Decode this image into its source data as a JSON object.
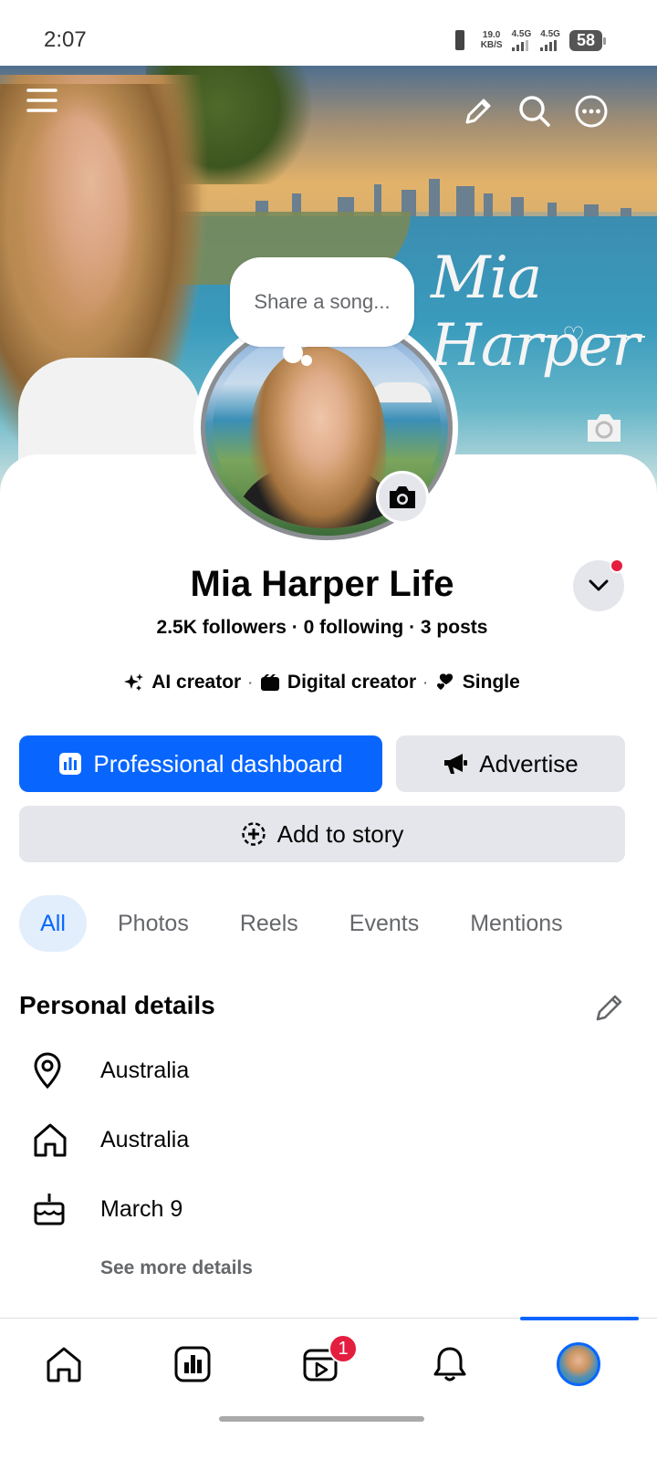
{
  "status_bar": {
    "time": "2:07",
    "net_speed_value": "19.0",
    "net_speed_unit": "KB/S",
    "signal1_label": "4.5G",
    "signal2_label": "4.5G",
    "battery": "58"
  },
  "cover": {
    "script_text": "Mia Harper",
    "heart": "♡"
  },
  "profile": {
    "song_prompt": "Share a song...",
    "name": "Mia Harper Life",
    "stats": "2.5K followers · 0 following · 3 posts",
    "tags": [
      {
        "label": "AI creator",
        "icon": "sparkle-icon"
      },
      {
        "label": "Digital creator",
        "icon": "clapper-icon"
      },
      {
        "label": "Single",
        "icon": "hearts-icon"
      }
    ],
    "tag_separator": "·"
  },
  "actions": {
    "dashboard": "Professional dashboard",
    "advertise": "Advertise",
    "add_story": "Add to story"
  },
  "tabs": [
    {
      "label": "All",
      "active": true
    },
    {
      "label": "Photos",
      "active": false
    },
    {
      "label": "Reels",
      "active": false
    },
    {
      "label": "Events",
      "active": false
    },
    {
      "label": "Mentions",
      "active": false
    }
  ],
  "personal_details": {
    "title": "Personal details",
    "items": [
      {
        "icon": "location-pin-icon",
        "text": "Australia"
      },
      {
        "icon": "home-icon",
        "text": "Australia"
      },
      {
        "icon": "birthday-cake-icon",
        "text": "March 9"
      }
    ],
    "see_more": "See more details"
  },
  "bottom_nav": {
    "items": [
      "home-icon",
      "dashboard-icon",
      "video-icon",
      "notifications-icon",
      "profile-avatar"
    ],
    "video_badge": "1"
  },
  "colors": {
    "brand_blue": "#0866ff",
    "button_gray": "#e4e6eb",
    "badge_red": "#e41e3f",
    "secondary_text": "#65676b"
  }
}
